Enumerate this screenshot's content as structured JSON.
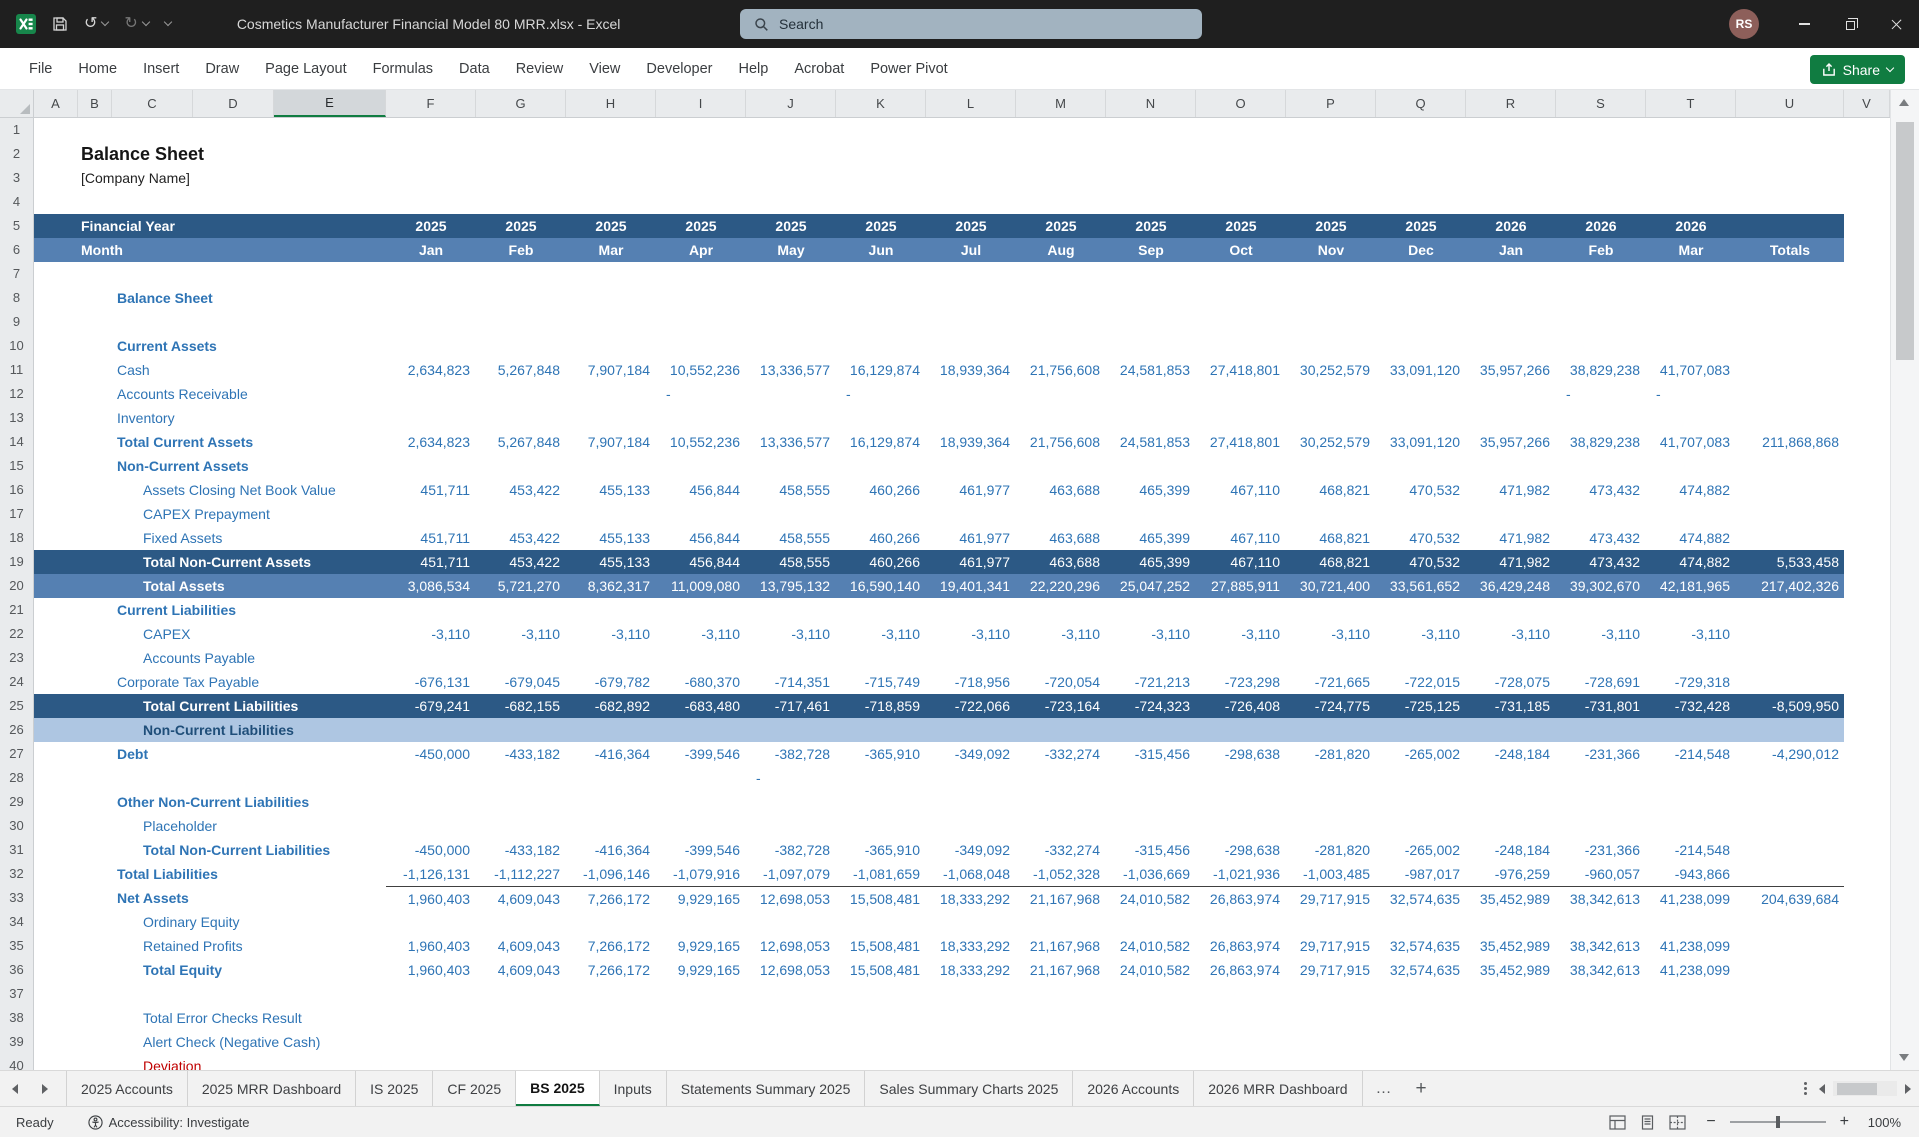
{
  "title_bar": {
    "document_title": "Cosmetics Manufacturer Financial Model 80 MRR.xlsx  -  Excel",
    "search_placeholder": "Search",
    "avatar_initials": "RS",
    "glyphs": {
      "undo": "↺",
      "redo": "↻"
    }
  },
  "menu": {
    "items": [
      "File",
      "Home",
      "Insert",
      "Draw",
      "Page Layout",
      "Formulas",
      "Data",
      "Review",
      "View",
      "Developer",
      "Help",
      "Acrobat",
      "Power Pivot"
    ],
    "share_label": "Share"
  },
  "colors": {
    "excel_green": "#107C41",
    "titlebar_bg": "#1F1F1F",
    "band_dark": "#2C5985",
    "band_mid": "#5580B2",
    "band_light": "#AEC6E2",
    "text_blue": "#2E74B5",
    "text_navy": "#1F4E79",
    "alert_red": "#C00000"
  },
  "grid": {
    "selected_column": "E",
    "column_letters": [
      "A",
      "B",
      "C",
      "D",
      "E",
      "F",
      "G",
      "H",
      "I",
      "J",
      "K",
      "L",
      "M",
      "N",
      "O",
      "P",
      "Q",
      "R",
      "S",
      "T",
      "U",
      "V"
    ],
    "header": {
      "financial_year_label": "Financial Year",
      "years": [
        "2025",
        "2025",
        "2025",
        "2025",
        "2025",
        "2025",
        "2025",
        "2025",
        "2025",
        "2025",
        "2025",
        "2025",
        "2026",
        "2026",
        "2026"
      ],
      "month_label": "Month",
      "months": [
        "Jan",
        "Feb",
        "Mar",
        "Apr",
        "May",
        "Jun",
        "Jul",
        "Aug",
        "Sep",
        "Oct",
        "Nov",
        "Dec",
        "Jan",
        "Feb",
        "Mar"
      ],
      "totals_label": "Totals"
    },
    "rows": [
      {
        "n": 1
      },
      {
        "n": 2,
        "label": "Balance Sheet",
        "style": "title"
      },
      {
        "n": 3,
        "label": "[Company Name]",
        "style": "plain"
      },
      {
        "n": 4
      },
      {
        "n": 5,
        "type": "year-header",
        "band": "dark"
      },
      {
        "n": 6,
        "type": "month-header",
        "band": "mid"
      },
      {
        "n": 7
      },
      {
        "n": 8,
        "label": "Balance Sheet",
        "style": "sec"
      },
      {
        "n": 9
      },
      {
        "n": 10,
        "label": "Current Assets",
        "style": "sec"
      },
      {
        "n": 11,
        "label": "Cash",
        "style": "item",
        "values": [
          "2,634,823",
          "5,267,848",
          "7,907,184",
          "10,552,236",
          "13,336,577",
          "16,129,874",
          "18,939,364",
          "21,756,608",
          "24,581,853",
          "27,418,801",
          "30,252,579",
          "33,091,120",
          "35,957,266",
          "38,829,238",
          "41,707,083"
        ]
      },
      {
        "n": 12,
        "label": "Accounts Receivable",
        "style": "item",
        "values": [
          "",
          "",
          "",
          "-",
          "",
          "-",
          "",
          "",
          "",
          "",
          "",
          "",
          "",
          "-",
          "-"
        ]
      },
      {
        "n": 13,
        "label": "Inventory",
        "style": "item"
      },
      {
        "n": 14,
        "label": "Total Current Assets",
        "style": "bold",
        "values": [
          "2,634,823",
          "5,267,848",
          "7,907,184",
          "10,552,236",
          "13,336,577",
          "16,129,874",
          "18,939,364",
          "21,756,608",
          "24,581,853",
          "27,418,801",
          "30,252,579",
          "33,091,120",
          "35,957,266",
          "38,829,238",
          "41,707,083"
        ],
        "total": "211,868,868"
      },
      {
        "n": 15,
        "label": "Non-Current Assets",
        "style": "sec"
      },
      {
        "n": 16,
        "label": "Assets Closing Net Book Value",
        "style": "item2",
        "values": [
          "451,711",
          "453,422",
          "455,133",
          "456,844",
          "458,555",
          "460,266",
          "461,977",
          "463,688",
          "465,399",
          "467,110",
          "468,821",
          "470,532",
          "471,982",
          "473,432",
          "474,882"
        ]
      },
      {
        "n": 17,
        "label": "CAPEX Prepayment",
        "style": "item2"
      },
      {
        "n": 18,
        "label": "Fixed Assets",
        "style": "item2",
        "values": [
          "451,711",
          "453,422",
          "455,133",
          "456,844",
          "458,555",
          "460,266",
          "461,977",
          "463,688",
          "465,399",
          "467,110",
          "468,821",
          "470,532",
          "471,982",
          "473,432",
          "474,882"
        ]
      },
      {
        "n": 19,
        "label": "Total Non-Current Assets",
        "style": "white2",
        "band": "dark",
        "values": [
          "451,711",
          "453,422",
          "455,133",
          "456,844",
          "458,555",
          "460,266",
          "461,977",
          "463,688",
          "465,399",
          "467,110",
          "468,821",
          "470,532",
          "471,982",
          "473,432",
          "474,882"
        ],
        "total": "5,533,458"
      },
      {
        "n": 20,
        "label": "Total Assets",
        "style": "white2",
        "band": "mid",
        "values": [
          "3,086,534",
          "5,721,270",
          "8,362,317",
          "11,009,080",
          "13,795,132",
          "16,590,140",
          "19,401,341",
          "22,220,296",
          "25,047,252",
          "27,885,911",
          "30,721,400",
          "33,561,652",
          "36,429,248",
          "39,302,670",
          "42,181,965"
        ],
        "total": "217,402,326"
      },
      {
        "n": 21,
        "label": "Current Liabilities",
        "style": "sec"
      },
      {
        "n": 22,
        "label": "CAPEX",
        "style": "item2",
        "values": [
          "-3,110",
          "-3,110",
          "-3,110",
          "-3,110",
          "-3,110",
          "-3,110",
          "-3,110",
          "-3,110",
          "-3,110",
          "-3,110",
          "-3,110",
          "-3,110",
          "-3,110",
          "-3,110",
          "-3,110"
        ]
      },
      {
        "n": 23,
        "label": "Accounts Payable",
        "style": "item2"
      },
      {
        "n": 24,
        "label": "Corporate Tax Payable",
        "style": "item",
        "values": [
          "-676,131",
          "-679,045",
          "-679,782",
          "-680,370",
          "-714,351",
          "-715,749",
          "-718,956",
          "-720,054",
          "-721,213",
          "-723,298",
          "-721,665",
          "-722,015",
          "-728,075",
          "-728,691",
          "-729,318"
        ]
      },
      {
        "n": 25,
        "label": "Total Current Liabilities",
        "style": "white2",
        "band": "dark",
        "values": [
          "-679,241",
          "-682,155",
          "-682,892",
          "-683,480",
          "-717,461",
          "-718,859",
          "-722,066",
          "-723,164",
          "-724,323",
          "-726,408",
          "-724,775",
          "-725,125",
          "-731,185",
          "-731,801",
          "-732,428"
        ],
        "total": "-8,509,950"
      },
      {
        "n": 26,
        "label": "Non-Current Liabilities",
        "style": "nav2",
        "band": "light"
      },
      {
        "n": 27,
        "label": "Debt",
        "style": "bold",
        "values": [
          "-450,000",
          "-433,182",
          "-416,364",
          "-399,546",
          "-382,728",
          "-365,910",
          "-349,092",
          "-332,274",
          "-315,456",
          "-298,638",
          "-281,820",
          "-265,002",
          "-248,184",
          "-231,366",
          "-214,548"
        ],
        "total": "-4,290,012"
      },
      {
        "n": 28,
        "values": [
          "",
          "",
          "",
          "",
          "-",
          "",
          "",
          "",
          "",
          "",
          "",
          "",
          "",
          "",
          ""
        ]
      },
      {
        "n": 29,
        "label": "Other Non-Current Liabilities",
        "style": "sec"
      },
      {
        "n": 30,
        "label": "Placeholder",
        "style": "item2"
      },
      {
        "n": 31,
        "label": "Total Non-Current Liabilities",
        "style": "bold2",
        "values": [
          "-450,000",
          "-433,182",
          "-416,364",
          "-399,546",
          "-382,728",
          "-365,910",
          "-349,092",
          "-332,274",
          "-315,456",
          "-298,638",
          "-281,820",
          "-265,002",
          "-248,184",
          "-231,366",
          "-214,548"
        ]
      },
      {
        "n": 32,
        "label": "Total Liabilities",
        "style": "bold",
        "values": [
          "-1,126,131",
          "-1,112,227",
          "-1,096,146",
          "-1,079,916",
          "-1,097,079",
          "-1,081,659",
          "-1,068,048",
          "-1,052,328",
          "-1,036,669",
          "-1,021,936",
          "-1,003,485",
          "-987,017",
          "-976,259",
          "-960,057",
          "-943,866"
        ]
      },
      {
        "n": 33,
        "label": "Net Assets",
        "style": "bold",
        "border_top": true,
        "values": [
          "1,960,403",
          "4,609,043",
          "7,266,172",
          "9,929,165",
          "12,698,053",
          "15,508,481",
          "18,333,292",
          "21,167,968",
          "24,010,582",
          "26,863,974",
          "29,717,915",
          "32,574,635",
          "35,452,989",
          "38,342,613",
          "41,238,099"
        ],
        "total": "204,639,684"
      },
      {
        "n": 34,
        "label": "Ordinary Equity",
        "style": "item2"
      },
      {
        "n": 35,
        "label": "Retained Profits",
        "style": "item2",
        "values": [
          "1,960,403",
          "4,609,043",
          "7,266,172",
          "9,929,165",
          "12,698,053",
          "15,508,481",
          "18,333,292",
          "21,167,968",
          "24,010,582",
          "26,863,974",
          "29,717,915",
          "32,574,635",
          "35,452,989",
          "38,342,613",
          "41,238,099"
        ]
      },
      {
        "n": 36,
        "label": "Total Equity",
        "style": "bold2",
        "values": [
          "1,960,403",
          "4,609,043",
          "7,266,172",
          "9,929,165",
          "12,698,053",
          "15,508,481",
          "18,333,292",
          "21,167,968",
          "24,010,582",
          "26,863,974",
          "29,717,915",
          "32,574,635",
          "35,452,989",
          "38,342,613",
          "41,238,099"
        ]
      },
      {
        "n": 37
      },
      {
        "n": 38,
        "label": "Total Error Checks Result",
        "style": "item2"
      },
      {
        "n": 39,
        "label": "Alert Check (Negative Cash)",
        "style": "item2"
      },
      {
        "n": 40,
        "label": "Deviation",
        "style": "red2"
      }
    ]
  },
  "sheet_tabs": {
    "items": [
      "2025 Accounts",
      "2025 MRR Dashboard",
      "IS 2025",
      "CF 2025",
      "BS 2025",
      "Inputs",
      "Statements Summary 2025",
      "Sales Summary Charts 2025",
      "2026 Accounts",
      "2026 MRR Dashboard"
    ],
    "active": "BS 2025",
    "more_glyph": "…",
    "add_glyph": "+"
  },
  "status_bar": {
    "mode": "Ready",
    "accessibility": "Accessibility: Investigate",
    "zoom_minus": "−",
    "zoom_plus": "+",
    "zoom": "100%"
  }
}
